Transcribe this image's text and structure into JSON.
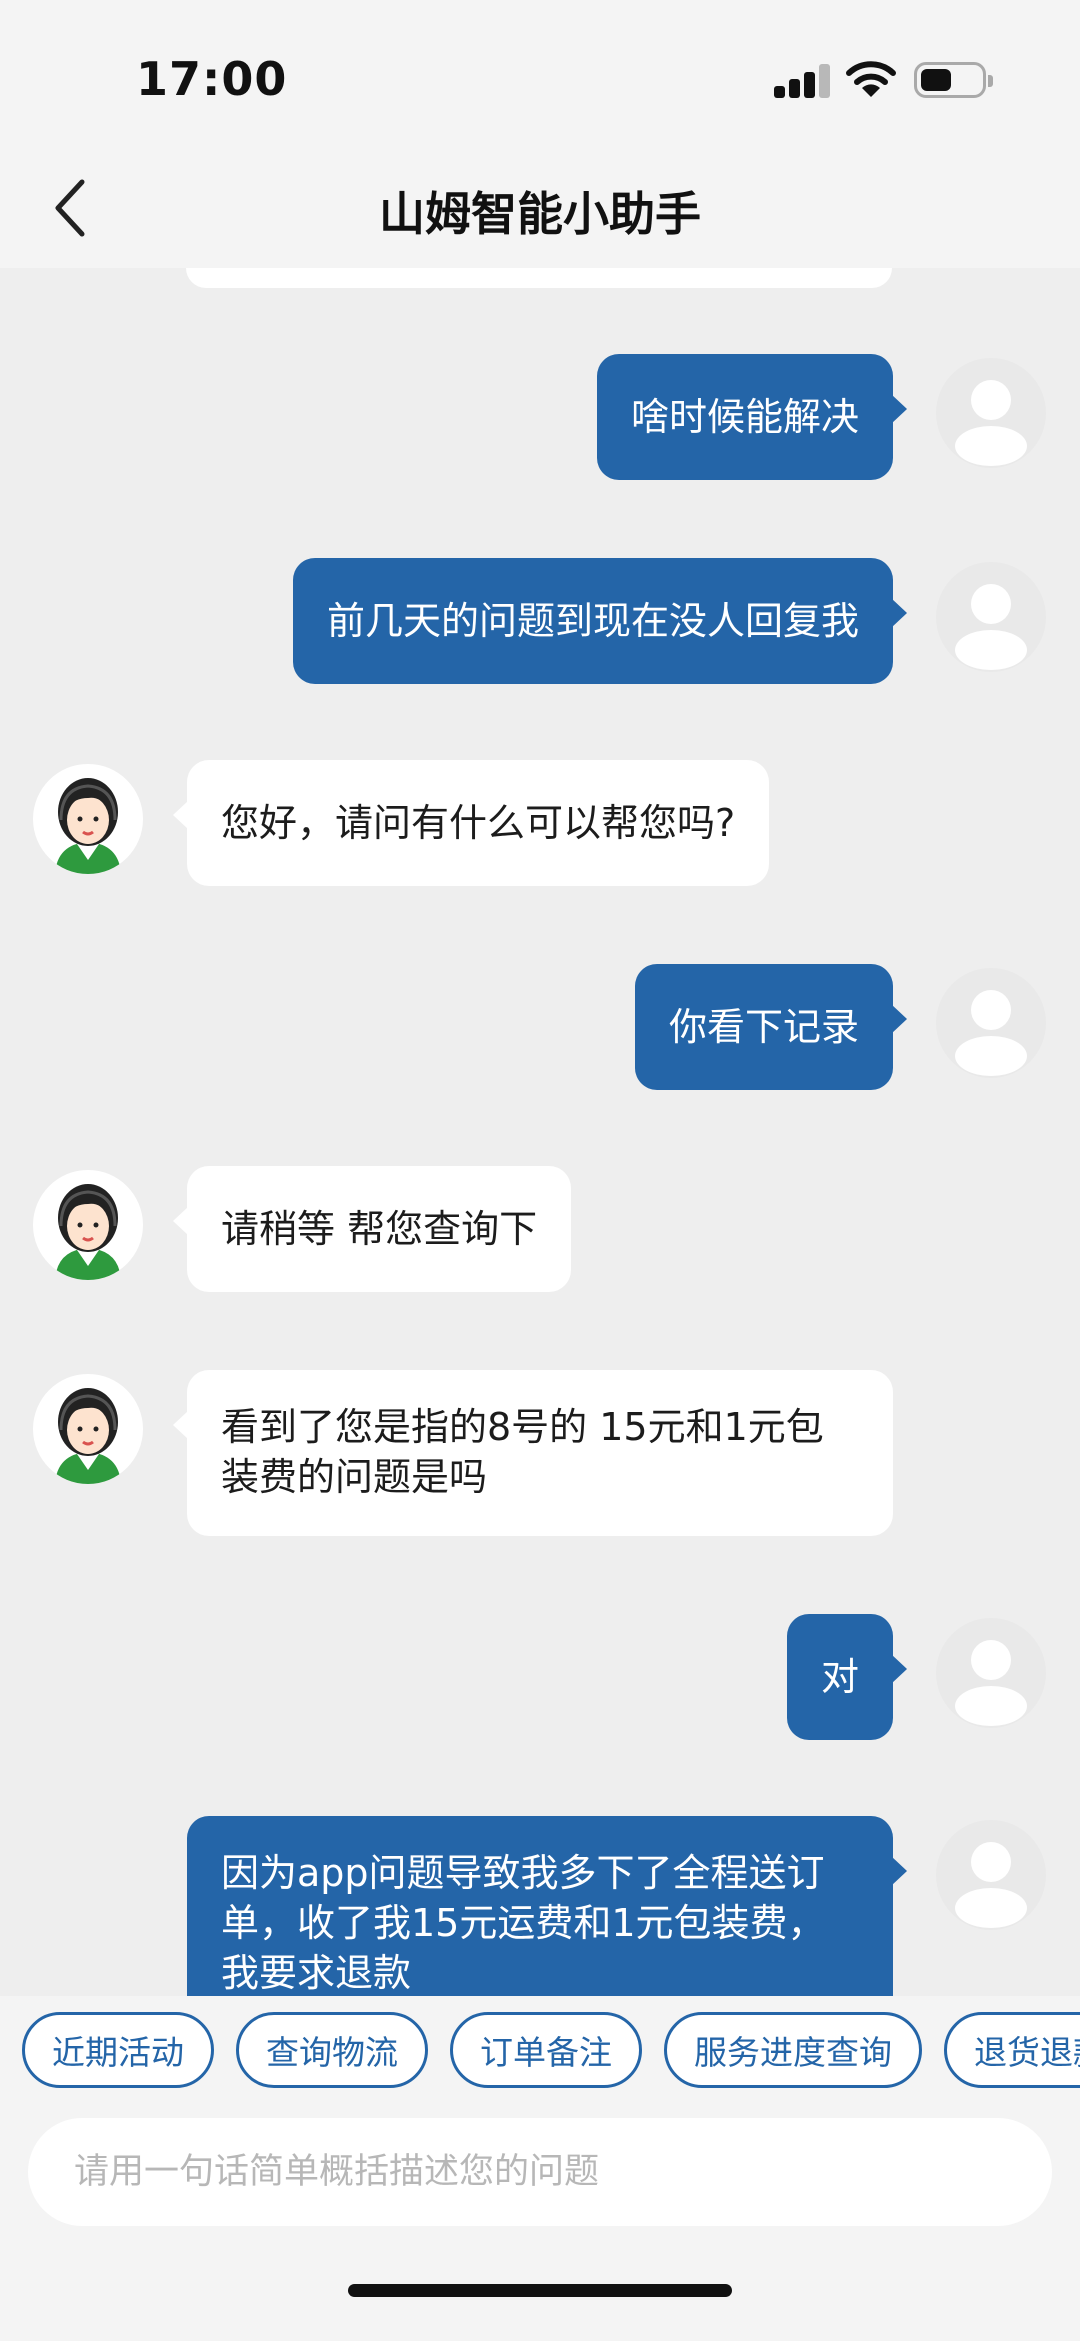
{
  "status_bar": {
    "time": "17:00"
  },
  "header": {
    "title": "山姆智能小助手"
  },
  "messages": [
    {
      "from": "user",
      "text": "啥时候能解决"
    },
    {
      "from": "user",
      "text": "前几天的问题到现在没人回复我"
    },
    {
      "from": "agent",
      "text": "您好，请问有什么可以帮您吗?"
    },
    {
      "from": "user",
      "text": "你看下记录"
    },
    {
      "from": "agent",
      "text": "请稍等 帮您查询下"
    },
    {
      "from": "agent",
      "text": "看到了您是指的8号的 15元和1元包装费的问题是吗"
    },
    {
      "from": "user",
      "text": "对"
    },
    {
      "from": "user",
      "text": "因为app问题导致我多下了全程送订单，收了我15元运费和1元包装费，我要求退款"
    }
  ],
  "quick_replies": [
    "近期活动",
    "查询物流",
    "订单备注",
    "服务进度查询",
    "退货退款"
  ],
  "input": {
    "placeholder": "请用一句话简单概括描述您的问题"
  },
  "colors": {
    "accent": "#2465a8",
    "background": "#eeeeee",
    "bubble_in": "#ffffff"
  },
  "icons": {
    "back": "chevron-left-icon",
    "signal": "signal-icon",
    "wifi": "wifi-icon",
    "battery": "battery-icon"
  }
}
